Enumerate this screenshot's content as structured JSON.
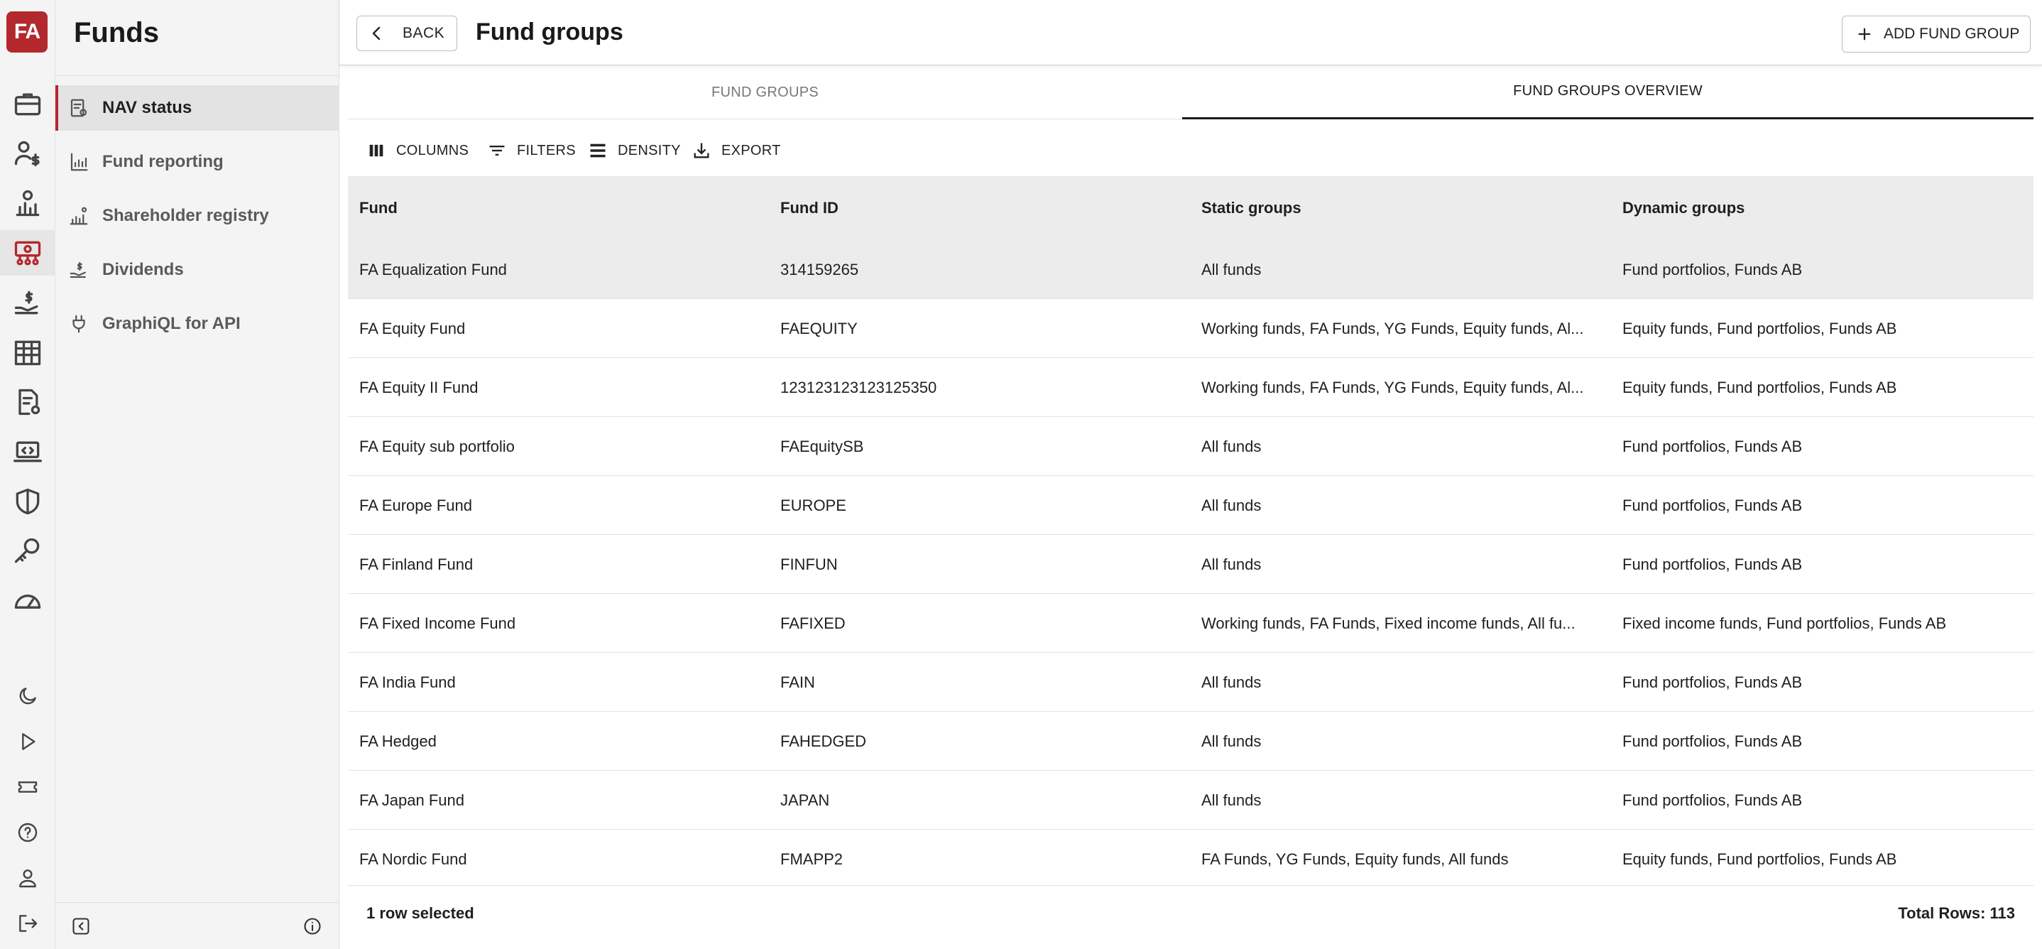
{
  "app": {
    "logo_text": "FA",
    "section_title": "Funds"
  },
  "rail": {
    "icons": [
      "briefcase-icon",
      "person-dollar-icon",
      "chart-doc-icon",
      "money-network-icon",
      "hand-dollar-icon",
      "building-icon",
      "doc-settings-icon",
      "laptop-code-icon",
      "shield-icon",
      "key-icon",
      "gauge-icon"
    ],
    "bottom_icons": [
      "moon-icon",
      "play-icon",
      "ticket-icon",
      "help-icon",
      "user-icon",
      "logout-icon"
    ]
  },
  "sidebar": {
    "items": [
      {
        "label": "NAV status",
        "icon": "nav-status-icon",
        "active": true
      },
      {
        "label": "Fund reporting",
        "icon": "bar-chart-icon",
        "active": false
      },
      {
        "label": "Shareholder registry",
        "icon": "people-chart-icon",
        "active": false
      },
      {
        "label": "Dividends",
        "icon": "hand-dollar-icon",
        "active": false
      },
      {
        "label": "GraphiQL for API",
        "icon": "plug-icon",
        "active": false
      }
    ]
  },
  "header": {
    "back_label": "BACK",
    "title": "Fund groups",
    "add_label": "ADD FUND GROUP"
  },
  "tabs": [
    {
      "label": "FUND GROUPS",
      "active": false
    },
    {
      "label": "FUND GROUPS OVERVIEW",
      "active": true
    }
  ],
  "toolbar": {
    "columns": "COLUMNS",
    "filters": "FILTERS",
    "density": "DENSITY",
    "export": "EXPORT"
  },
  "table": {
    "columns": [
      "Fund",
      "Fund ID",
      "Static groups",
      "Dynamic groups"
    ],
    "rows": [
      [
        "FA Equalization Fund",
        "314159265",
        "All funds",
        "Fund portfolios, Funds AB"
      ],
      [
        "FA Equity Fund",
        "FAEQUITY",
        "Working funds, FA Funds, YG Funds, Equity funds, Al...",
        "Equity funds, Fund portfolios, Funds AB"
      ],
      [
        "FA Equity II Fund",
        "123123123123125350",
        "Working funds, FA Funds, YG Funds, Equity funds, Al...",
        "Equity funds, Fund portfolios, Funds AB"
      ],
      [
        "FA Equity sub portfolio",
        "FAEquitySB",
        "All funds",
        "Fund portfolios, Funds AB"
      ],
      [
        "FA Europe Fund",
        "EUROPE",
        "All funds",
        "Fund portfolios, Funds AB"
      ],
      [
        "FA Finland Fund",
        "FINFUN",
        "All funds",
        "Fund portfolios, Funds AB"
      ],
      [
        "FA Fixed Income Fund",
        "FAFIXED",
        "Working funds, FA Funds, Fixed income funds, All fu...",
        "Fixed income funds, Fund portfolios, Funds AB"
      ],
      [
        "FA India Fund",
        "FAIN",
        "All funds",
        "Fund portfolios, Funds AB"
      ],
      [
        "FA Hedged",
        "FAHEDGED",
        "All funds",
        "Fund portfolios, Funds AB"
      ],
      [
        "FA Japan Fund",
        "JAPAN",
        "All funds",
        "Fund portfolios, Funds AB"
      ],
      [
        "FA Nordic Fund",
        "FMAPP2",
        "FA Funds, YG Funds, Equity funds, All funds",
        "Equity funds, Fund portfolios, Funds AB"
      ]
    ],
    "selected_row": 0
  },
  "footer": {
    "selected_text": "1 row selected",
    "total_text": "Total Rows: 113"
  },
  "colors": {
    "brand": "#b3282d",
    "selected_row": "#ececec",
    "header_bg": "#ececec"
  }
}
